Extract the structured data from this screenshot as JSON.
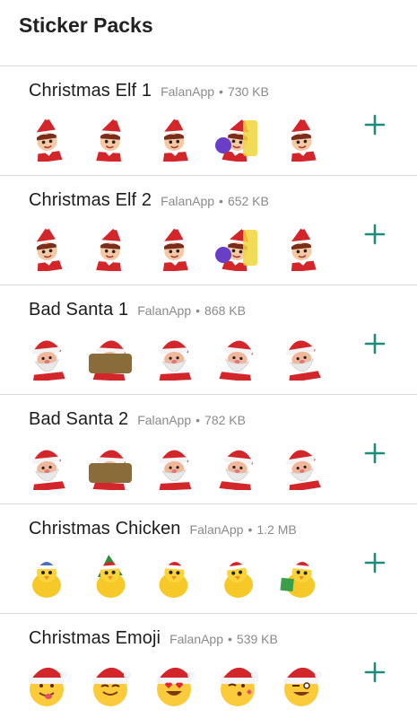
{
  "app_bar": {
    "title": "Sticker Packs"
  },
  "colors": {
    "accent": "#1e8c7a",
    "divider": "#d9d9d9",
    "subtle_text": "#8a8a8a"
  },
  "packs": [
    {
      "name": "Christmas Elf 1",
      "publisher": "FalanApp",
      "separator": "•",
      "size": "730 KB",
      "stickers": [
        "elf-heart",
        "elf-goggles",
        "elf-wave",
        "elf-hello-ornament",
        "elf-scared"
      ],
      "theme": "elf"
    },
    {
      "name": "Christmas Elf 2",
      "publisher": "FalanApp",
      "separator": "•",
      "size": "652 KB",
      "stickers": [
        "elf-lights",
        "elf-bag",
        "elf-thinking",
        "elf-point",
        "elf-laugh"
      ],
      "theme": "elf"
    },
    {
      "name": "Bad Santa 1",
      "publisher": "FalanApp",
      "separator": "•",
      "size": "868 KB",
      "stickers": [
        "santa-grumpy",
        "santa-kiss",
        "santa-shout",
        "kid-hi-sign",
        "santa-fallen"
      ],
      "theme": "santa"
    },
    {
      "name": "Bad Santa 2",
      "publisher": "FalanApp",
      "separator": "•",
      "size": "782 KB",
      "stickers": [
        "santa-frown",
        "santa-car",
        "santa-get-out-sign",
        "santa-snow-hut",
        "santa-ok"
      ],
      "theme": "santa"
    },
    {
      "name": "Christmas Chicken",
      "publisher": "FalanApp",
      "separator": "•",
      "size": "1.2 MB",
      "stickers": [
        "chick-hat",
        "chick-tree",
        "chick-santa",
        "chick-dance",
        "chick-gift"
      ],
      "theme": "chick"
    },
    {
      "name": "Christmas Emoji",
      "publisher": "FalanApp",
      "separator": "•",
      "size": "539 KB",
      "stickers": [
        "emoji-tongue",
        "emoji-smile",
        "emoji-heart-eyes",
        "emoji-kiss",
        "emoji-wink"
      ],
      "theme": "emoji"
    }
  ],
  "add_icon": "plus-icon"
}
